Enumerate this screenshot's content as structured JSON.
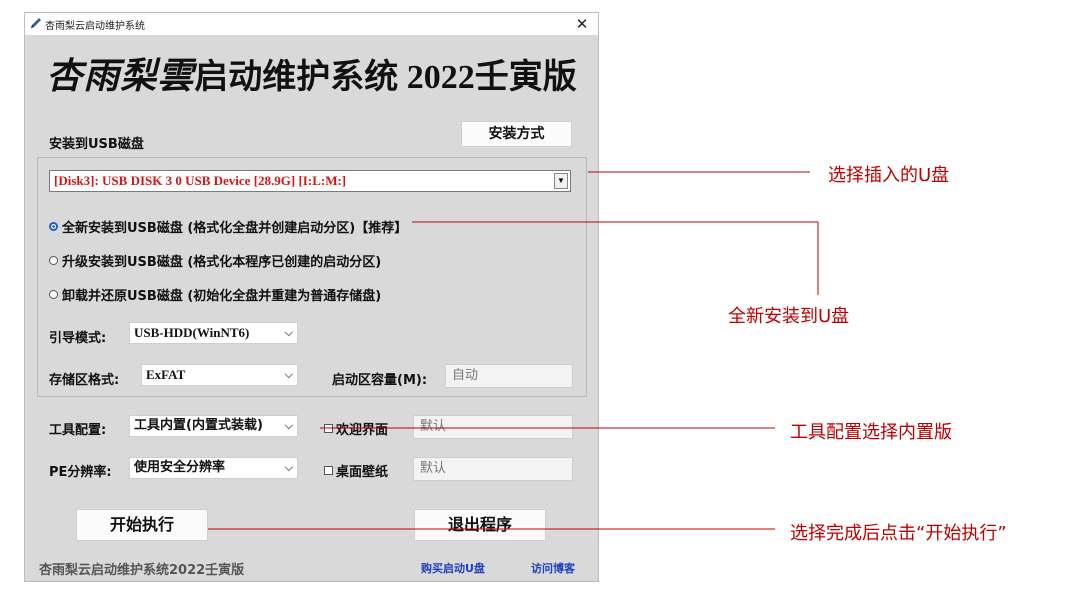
{
  "window": {
    "title": "杏雨梨云启动维护系统",
    "close_glyph": "✕",
    "brand_calligraphy": "杏雨梨雲",
    "brand_rest": "启动维护系统 2022壬寅版"
  },
  "install": {
    "section_label": "安装到USB磁盘",
    "method_button": "安装方式",
    "disk_value": "[Disk3]:  USB DISK 3 0 USB Device  [28.9G]  [I:L:M:]",
    "options": [
      {
        "label": "全新安装到USB磁盘 (格式化全盘并创建启动分区)【推荐】",
        "selected": true
      },
      {
        "label": "升级安装到USB磁盘 (格式化本程序已创建的启动分区)",
        "selected": false
      },
      {
        "label": "卸载并还原USB磁盘 (初始化全盘并重建为普通存储盘)",
        "selected": false
      }
    ]
  },
  "settings": {
    "boot_mode_label": "引导模式:",
    "boot_mode_value": "USB-HDD(WinNT6)",
    "storage_format_label": "存储区格式:",
    "storage_format_value": "ExFAT",
    "boot_size_label": "启动区容量(M):",
    "boot_size_value": "自动",
    "tool_config_label": "工具配置:",
    "tool_config_value": "工具内置(内置式装载)",
    "welcome_label": "欢迎界面",
    "welcome_value": "默认",
    "pe_res_label": "PE分辨率:",
    "pe_res_value": "使用安全分辨率",
    "wallpaper_label": "桌面壁纸",
    "wallpaper_value": "默认"
  },
  "actions": {
    "start_button": "开始执行",
    "exit_button": "退出程序"
  },
  "footer": {
    "product_name": "杏雨梨云启动维护系统2022壬寅版",
    "buy_link": "购买启动U盘",
    "blog_link": "访问博客"
  },
  "annotations": {
    "select_disk": "选择插入的U盘",
    "fresh_install": "全新安装到U盘",
    "tool_config": "工具配置选择内置版",
    "start_hint": "选择完成后点击“开始执行”",
    "color": "#c00000"
  },
  "icons": {
    "title_icon": "pen-icon",
    "chevron": "⌵"
  }
}
